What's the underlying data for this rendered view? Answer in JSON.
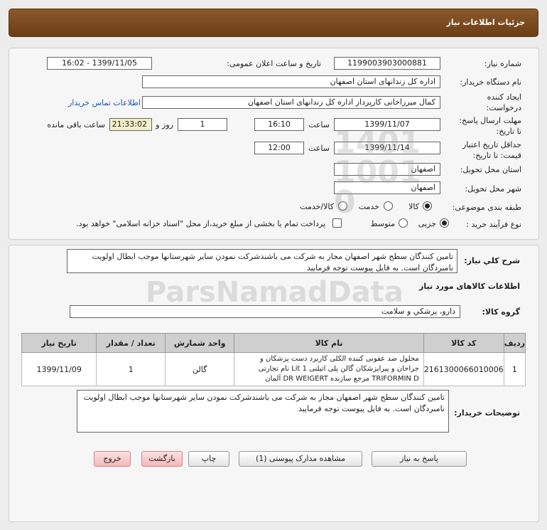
{
  "header": {
    "title": "جزئیات اطلاعات نیاز"
  },
  "labels": {
    "need_number": "شماره نیاز:",
    "announce_datetime": "تاریخ و ساعت اعلان عمومی:",
    "buyer_org": "نام دستگاه خریدار:",
    "creator": "ایجاد کننده درخواست:",
    "send_deadline": "مهلت ارسال پاسخ: تا تاریخ:",
    "time": "ساعت",
    "day_and": "روز و",
    "remaining": "ساعت باقی مانده",
    "price_validity": "حداقل تاریخ اعتبار قیمت: تا تاریخ:",
    "delivery_province": "استان محل تحویل:",
    "delivery_city": "شهر محل تحویل:",
    "subject_category": "طبقه بندی موضوعی:",
    "purchase_process": "نوع فرآیند خرید :",
    "general_description": "شرح کلي نياز:",
    "goods_info": "اطلاعات کالاهای مورد نیاز",
    "goods_group": "گروه کالا:",
    "buyer_notes": "توضیحات خریدار:"
  },
  "fields": {
    "need_number": "1199003903000881",
    "announce_datetime": "1399/11/05 - 16:02",
    "buyer_org": "اداره کل زندانهای استان اصفهان",
    "creator": "کمال میرزاخانی کارپرداز اداره کل زندانهای استان اصفهان",
    "contact_link": "اطلاعات تماس خریدار",
    "send_date": "1399/11/07",
    "send_time": "16:10",
    "days": "1",
    "remaining_time": "21:33:02",
    "validity_date": "1399/11/14",
    "validity_time": "12:00",
    "province": "اصفهان",
    "city": "اصفهان",
    "goods_group": "دارو، پزشكي و سلامت"
  },
  "category_options": [
    {
      "label": "کالا",
      "selected": true
    },
    {
      "label": "خدمت",
      "selected": false
    },
    {
      "label": "کالا/خدمت",
      "selected": false
    }
  ],
  "process_options": [
    {
      "label": "جزیی",
      "selected": true
    },
    {
      "label": "متوسط",
      "selected": false
    }
  ],
  "treasury_note": "پرداخت تمام یا بخشی از مبلغ خرید،از محل \"اسناد خزانه اسلامی\" خواهد بود.",
  "general_description": "تامین کنندگان سطح شهر اصفهان مجاز به شرکت می باشندشرکت نمودن سایر شهرستانها موجب ابطال اولویت نامبردگان است. به فایل پیوست توجه فرمایید",
  "table": {
    "headers": [
      "ردیف",
      "کد کالا",
      "نام کالا",
      "واحد شمارش",
      "تعداد / مقدار",
      "تاریخ نیاز"
    ],
    "rows": [
      {
        "index": "1",
        "code": "2161300066010006",
        "name": "محلول ضد عفونی کننده الکلی کاربرد دست پزشکان و جراحان و پیراپزشکان گالن پلی اتیلنی Lit 1 نام تجارتی TRIFORMIN D مرجع سازنده DR WEIGERT آلمان",
        "unit": "گالن",
        "quantity": "1",
        "date": "1399/11/09"
      }
    ]
  },
  "buyer_notes": "تامین کنندگان سطح شهر اصفهان مجاز به شرکت می باشندشرکت نمودن سایر شهرستانها موجب ابطال اولویت نامبردگان است. به فایل پیوست توجه فرمایید",
  "buttons": {
    "reply": "پاسخ به نیاز",
    "view_docs": "مشاهده مدارک پیوستی (1)",
    "print": "چاپ",
    "back": "بازگشت",
    "exit": "خروج"
  },
  "watermark": {
    "brand": "ParsNamadData",
    "digits": "1401\n1001\n0"
  }
}
